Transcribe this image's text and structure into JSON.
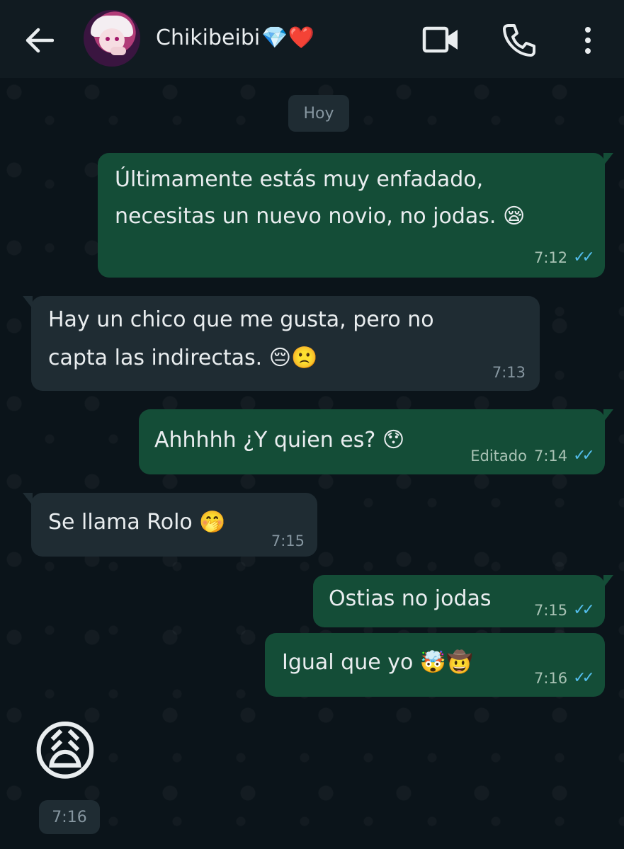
{
  "header": {
    "contact_name": "Chikibeibi",
    "contact_emojis": "💎❤️",
    "icons": [
      "arrow-back-icon",
      "avatar",
      "video-call-icon",
      "phone-icon",
      "more-vertical-icon"
    ]
  },
  "chat": {
    "date_label": "Hoy",
    "messages": [
      {
        "direction": "out",
        "lines": [
          "Últimamente estás muy enfadado,",
          "necesitas un nuevo novio, no jodas. 😪"
        ],
        "time": "7:12",
        "read": true
      },
      {
        "direction": "in",
        "lines": [
          "Hay un chico que me gusta, pero no",
          "capta las indirectas. 😔🙁"
        ],
        "time": "7:13"
      },
      {
        "direction": "out",
        "lines": [
          "Ahhhhh ¿Y quien es? 😯"
        ],
        "edited_label": "Editado",
        "time": "7:14",
        "read": true
      },
      {
        "direction": "in",
        "lines": [
          "Se llama Rolo 🤭"
        ],
        "time": "7:15"
      },
      {
        "direction": "out",
        "lines": [
          "Ostias no jodas"
        ],
        "time": "7:15",
        "read": true
      },
      {
        "direction": "out",
        "lines": [
          "Igual que yo 🤯🤠"
        ],
        "time": "7:16",
        "read": true
      },
      {
        "direction": "in",
        "lines": [
          "😩"
        ],
        "time": "7:16",
        "jumbo": true
      }
    ],
    "read_ticks": "✓✓",
    "colors": {
      "outgoing_bubble": "#144d37",
      "incoming_bubble": "#1f2c33",
      "read_tick": "#53bdeb",
      "background": "#0b141a"
    }
  }
}
